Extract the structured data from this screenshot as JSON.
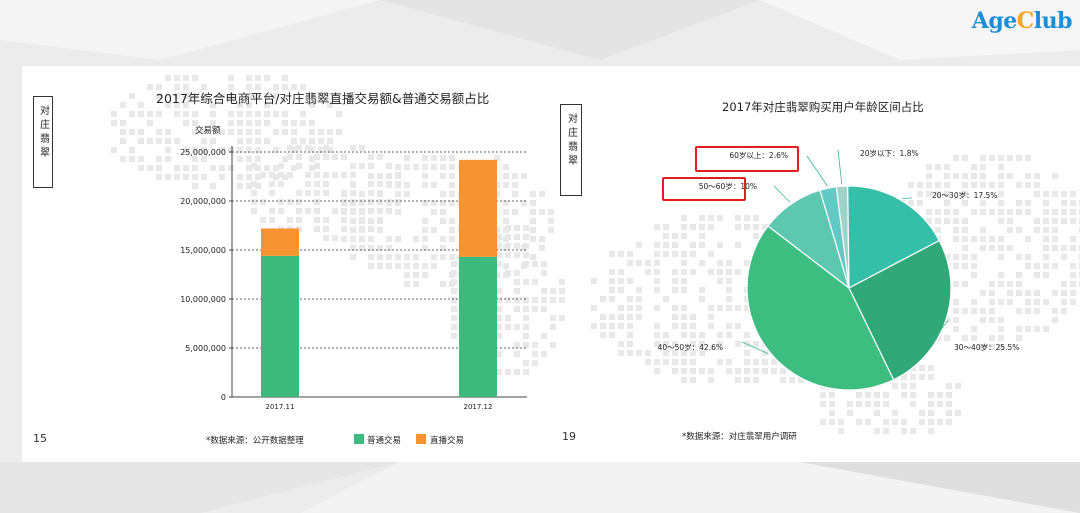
{
  "brand": {
    "logo_main": "Age",
    "logo_accent": "C",
    "logo_rest": "lub"
  },
  "left_panel": {
    "side_label": "对庄翡翠",
    "page_number": "15",
    "source_note": "*数据来源：公开数据整理",
    "legend": [
      {
        "name": "普通交易",
        "color": "#3dba7e"
      },
      {
        "name": "直播交易",
        "color": "#f79431"
      }
    ]
  },
  "right_panel": {
    "side_label": "对庄翡翠",
    "page_number": "19",
    "source_note": "*数据来源：对庄翡翠用户调研"
  },
  "chart_data": [
    {
      "type": "bar",
      "stacked": true,
      "title": "2017年综合电商平台/对庄翡翠直播交易额&普通交易额占比",
      "ylabel": "交易额",
      "categories": [
        "2017.11",
        "2017.12"
      ],
      "series": [
        {
          "name": "普通交易",
          "values": [
            14400000,
            14300000
          ],
          "color": "#3dba7e"
        },
        {
          "name": "直播交易",
          "values": [
            2800000,
            9900000
          ],
          "color": "#f79431"
        }
      ],
      "ylim": [
        0,
        25000000
      ],
      "yticks": [
        "0",
        "5,000,000",
        "10,000,000",
        "15,000,000",
        "20,000,000",
        "25,000,000"
      ],
      "grid": true
    },
    {
      "type": "pie",
      "title": "2017年对庄翡翠购买用户年龄区间占比",
      "slices": [
        {
          "label": "20岁以下：1.8%",
          "value": 1.8,
          "color": "#9fd3c7"
        },
        {
          "label": "20～30岁：17.5%",
          "value": 17.5,
          "color": "#35bfa8"
        },
        {
          "label": "30～40岁：25.5%",
          "value": 25.5,
          "color": "#30a878"
        },
        {
          "label": "40～50岁：42.6%",
          "value": 42.6,
          "color": "#3dbd80"
        },
        {
          "label": "50～60岁：10%",
          "value": 10,
          "color": "#5ec7b0"
        },
        {
          "label": "60岁以上：2.6%",
          "value": 2.6,
          "color": "#62c9c4"
        }
      ],
      "highlighted": [
        "50～60岁：10%",
        "60岁以上：2.6%"
      ],
      "highlight_color": "#e02020"
    }
  ]
}
